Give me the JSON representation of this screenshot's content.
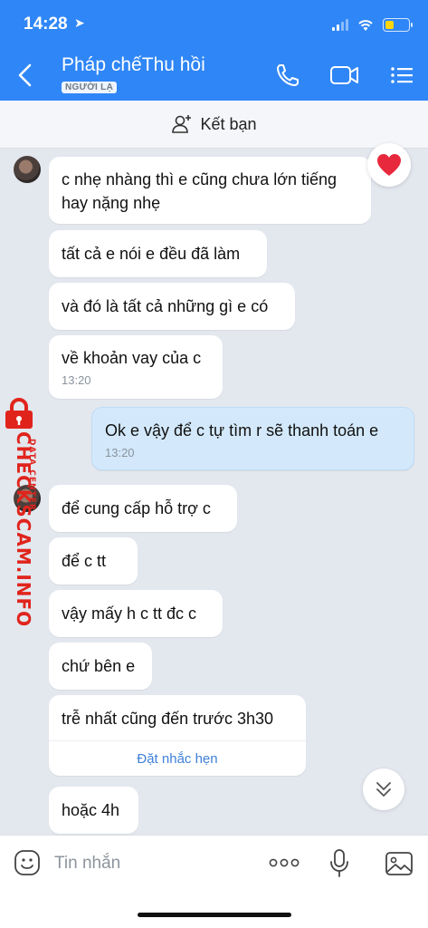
{
  "status": {
    "time": "14:28"
  },
  "header": {
    "title": "Pháp chếThu hồi",
    "badge": "NGƯỜI LẠ"
  },
  "friend_bar": {
    "label": "Kết bạn"
  },
  "messages": [
    {
      "text": "c nhẹ nhàng thì e cũng chưa lớn tiếng hay nặng nhẹ",
      "direction": "received"
    },
    {
      "text": "tất cả e nói e đều đã làm",
      "direction": "received"
    },
    {
      "text": "và đó là tất cả những gì e có",
      "direction": "received"
    },
    {
      "text": "về khoản vay của c",
      "time": "13:20",
      "direction": "received"
    },
    {
      "text": "Ok e vậy để c tự tìm r sẽ thanh toán e",
      "time": "13:20",
      "direction": "sent"
    },
    {
      "text": "để cung cấp hỗ trợ c",
      "direction": "received"
    },
    {
      "text": "để c tt",
      "direction": "received"
    },
    {
      "text": "vậy mấy h c tt đc c",
      "direction": "received"
    },
    {
      "text": "chứ bên e",
      "direction": "received"
    },
    {
      "text": "trễ nhất cũng đến trước 3h30",
      "reminder": "Đặt nhắc hẹn",
      "direction": "received"
    },
    {
      "text": "hoặc 4h",
      "direction": "received"
    }
  ],
  "watermark": {
    "brand": "CHECKSCAM.INFO",
    "tag": "DATA CENTER"
  },
  "input": {
    "placeholder": "Tin nhắn"
  },
  "colors": {
    "header": "#2f86f6",
    "sent_bubble": "#d3e9fb",
    "link": "#3f80d9",
    "watermark": "#e0241c"
  }
}
